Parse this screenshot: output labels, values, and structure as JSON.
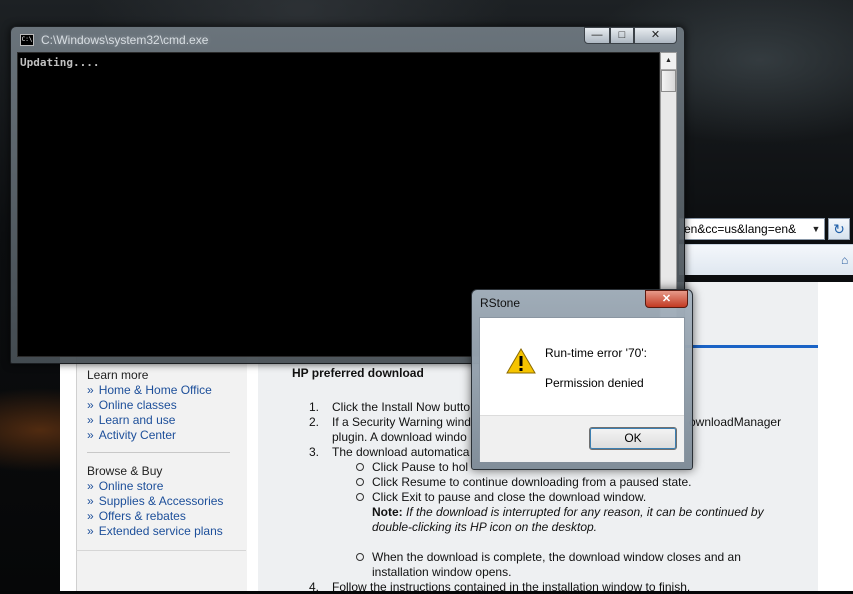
{
  "cmd": {
    "title": "C:\\Windows\\system32\\cmd.exe",
    "output": "Updating....",
    "icon_text": "C:\\"
  },
  "browser": {
    "address_fragment": "en&cc=us&lang=en&",
    "left_nav": {
      "learn_more_heading": "Learn more",
      "learn_more_links": [
        "Home & Home Office",
        "Online classes",
        "Learn and use",
        "Activity Center"
      ],
      "browse_buy_heading": "Browse & Buy",
      "browse_buy_links": [
        "Online store",
        "Supplies & Accessories",
        "Offers & rebates",
        "Extended service plans"
      ]
    },
    "content": {
      "title": "HP preferred download",
      "item1": "Click the Install Now butto",
      "item2_line1": "If a Security Warning wind",
      "item2_line1_right": "ownloadManager",
      "item2_line2": "plugin. A download windo",
      "item3": "The download automatica",
      "sub1": "Click Pause to hol",
      "sub2": "Click Resume to continue downloading from a paused state.",
      "sub3": "Click Exit to pause and close the download window.",
      "note_label": "Note:",
      "note_text": "If the download is interrupted for any reason, it can be continued by",
      "note_text2": "double-clicking its HP icon on the desktop.",
      "sub4_line1": "When the download is complete, the download window closes and an",
      "sub4_line2": "installation window opens.",
      "item4": "Follow the instructions contained in the installation window to finish."
    }
  },
  "dialog": {
    "title": "RStone",
    "message1": "Run-time error '70':",
    "message2": "Permission denied",
    "ok_label": "OK",
    "icon": "warning-icon"
  },
  "colors": {
    "link": "#1d4f9a",
    "accent_rule": "#1a63c6",
    "close_red": "#c23a22"
  }
}
